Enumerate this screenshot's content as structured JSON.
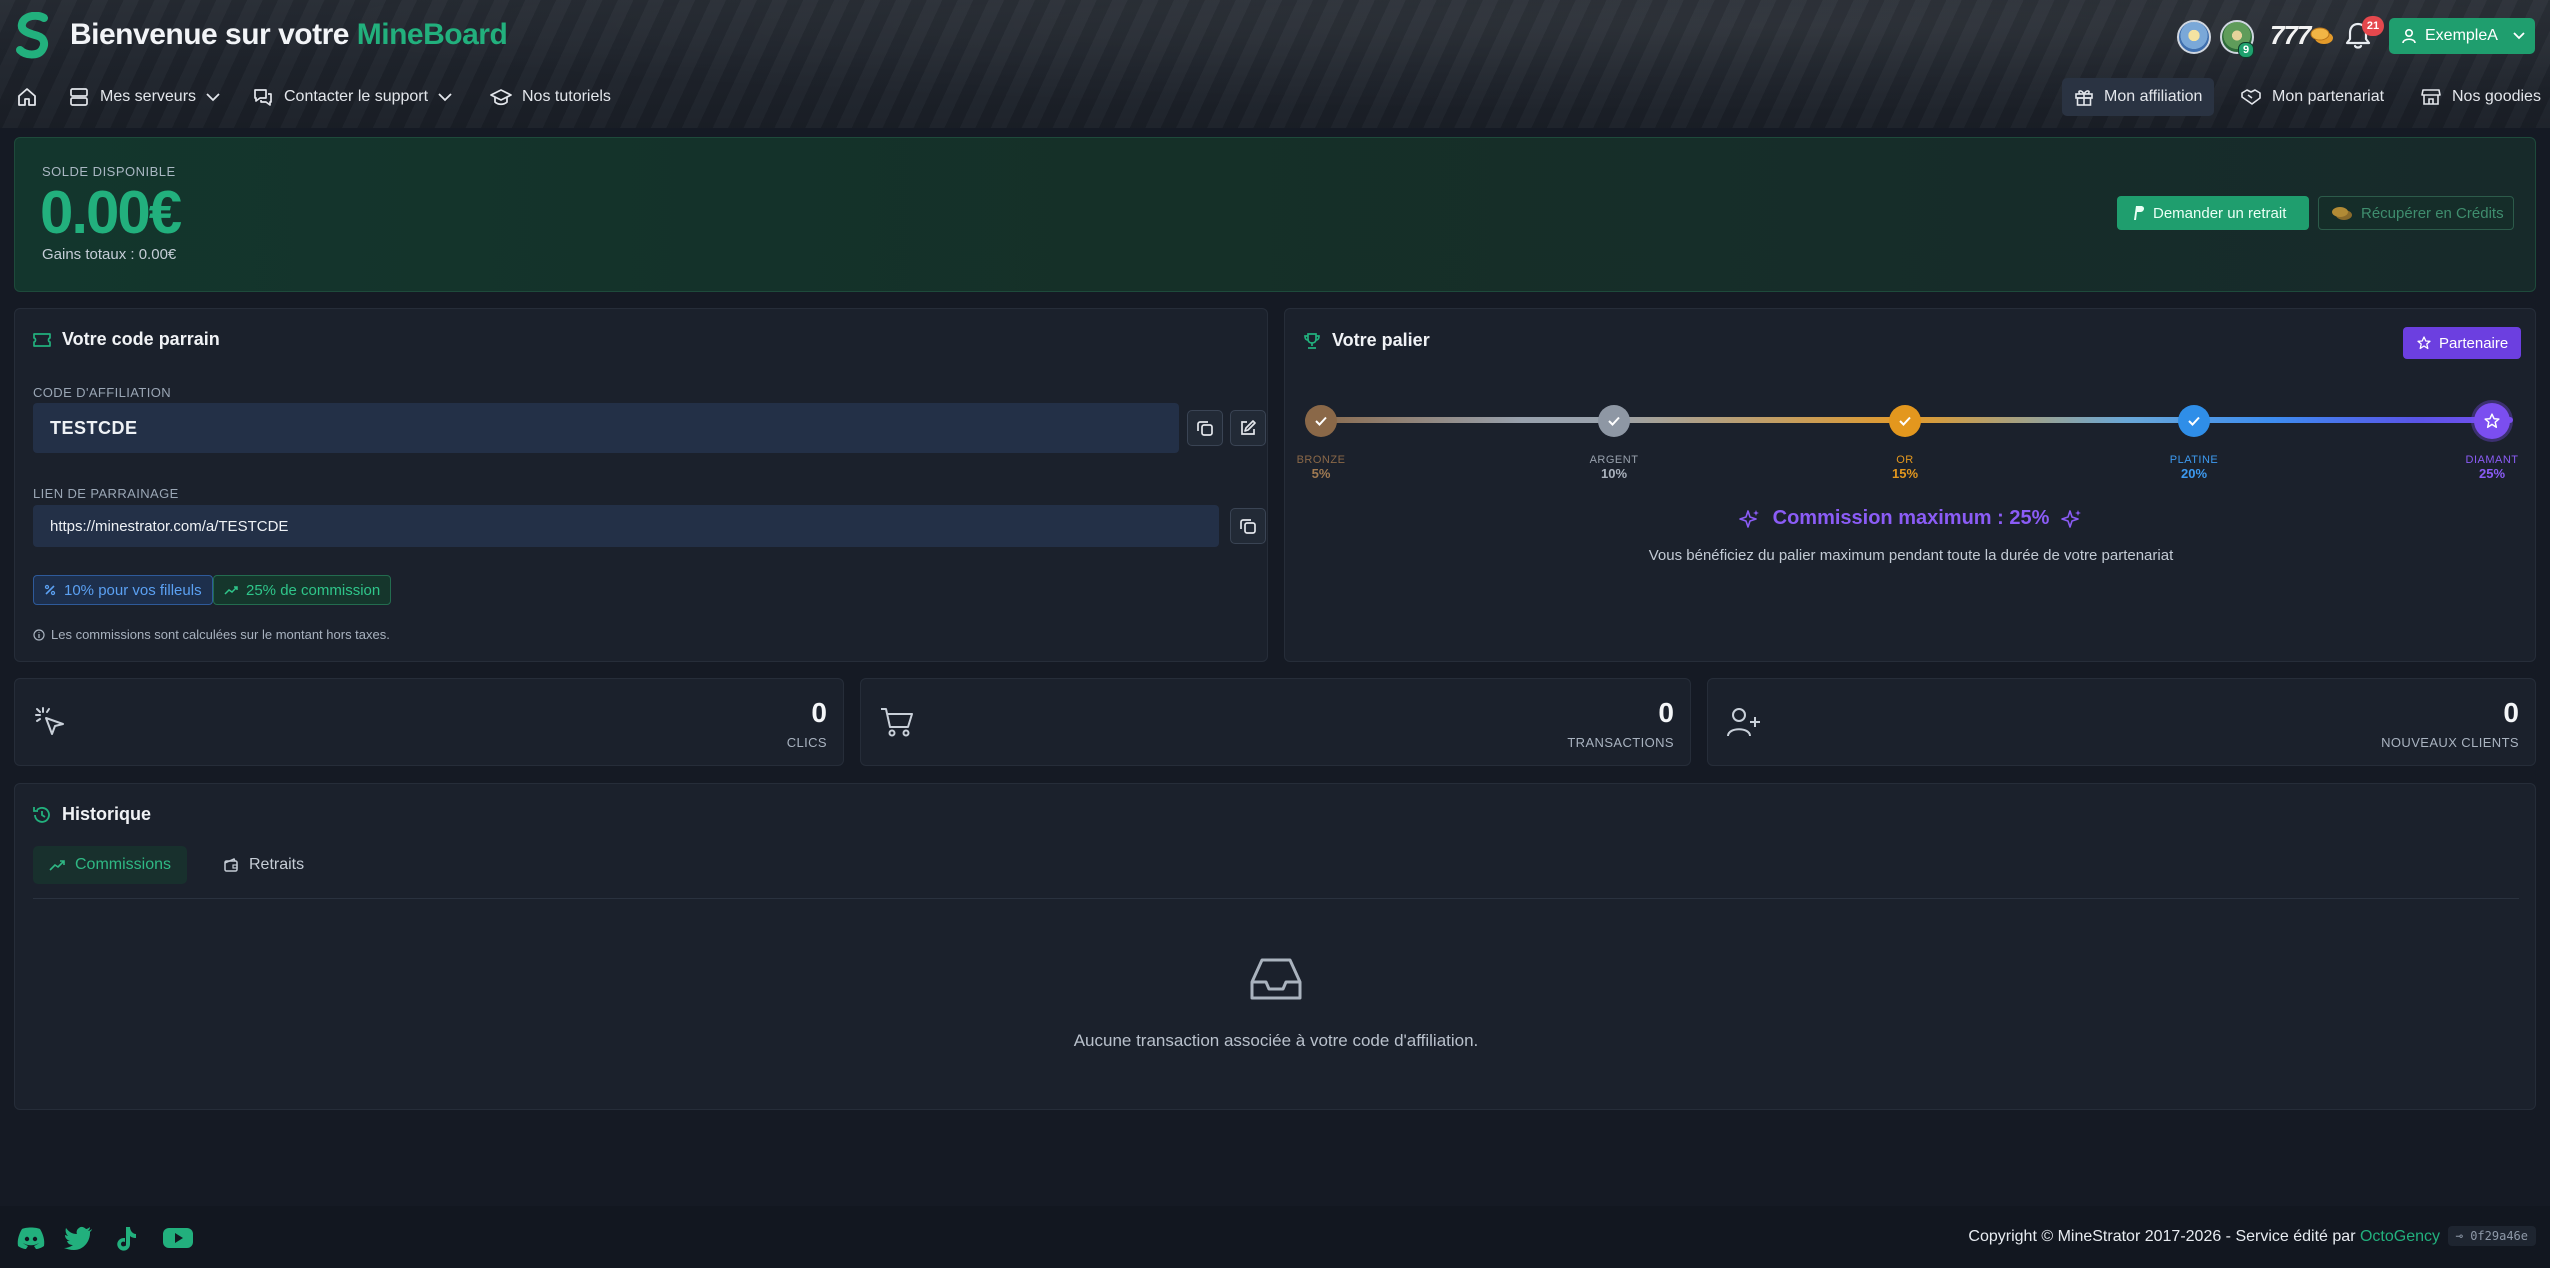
{
  "header": {
    "title_prefix": "Bienvenue sur votre",
    "title_brand": "MineBoard",
    "profile_badge": "9",
    "credits": "777",
    "notifications_count": "21",
    "username": "ExempleA"
  },
  "nav": {
    "left": [
      {
        "label": "Mes serveurs"
      },
      {
        "label": "Contacter le support"
      },
      {
        "label": "Nos tutoriels"
      }
    ],
    "right": [
      {
        "label": "Mon affiliation",
        "active": true
      },
      {
        "label": "Mon partenariat"
      },
      {
        "label": "Nos goodies"
      }
    ]
  },
  "balance": {
    "label": "SOLDE DISPONIBLE",
    "value": "0.00€",
    "total": "Gains totaux : 0.00€",
    "withdraw_label": "Demander un retrait",
    "credits_label": "Récupérer en Crédits"
  },
  "referral": {
    "title": "Votre code parrain",
    "code_label": "CODE D'AFFILIATION",
    "code": "TESTCDE",
    "link_label": "LIEN DE PARRAINAGE",
    "link": "https://minestrator.com/a/TESTCDE",
    "pill_referrals": "10% pour vos filleuls",
    "pill_commission": "25% de commission",
    "note": "Les commissions sont calculées sur le montant hors taxes."
  },
  "tier": {
    "title": "Votre palier",
    "badge": "Partenaire",
    "levels": [
      {
        "name": "BRONZE",
        "pct": "5%",
        "color": "#8a6848"
      },
      {
        "name": "ARGENT",
        "pct": "10%",
        "color": "#8e97a4"
      },
      {
        "name": "OR",
        "pct": "15%",
        "color": "#e3971e"
      },
      {
        "name": "PLATINE",
        "pct": "20%",
        "color": "#2f8ee8"
      },
      {
        "name": "DIAMANT",
        "pct": "25%",
        "color": "#7b4ef0"
      }
    ],
    "max_commission": "Commission maximum : 25%",
    "max_sub": "Vous bénéficiez du palier maximum pendant toute la durée de votre partenariat"
  },
  "stats": [
    {
      "value": "0",
      "label": "CLICS"
    },
    {
      "value": "0",
      "label": "TRANSACTIONS"
    },
    {
      "value": "0",
      "label": "NOUVEAUX CLIENTS"
    }
  ],
  "history": {
    "title": "Historique",
    "tabs": [
      "Commissions",
      "Retraits"
    ],
    "empty": "Aucune transaction associée à votre code d'affiliation."
  },
  "footer": {
    "copyright": "Copyright © MineStrator 2017-2026 - Service édité par",
    "publisher": "OctoGency",
    "version": "⊸ 0f29a46e"
  },
  "colors": {
    "accent": "#22b07d",
    "purple": "#6c3fe0"
  }
}
